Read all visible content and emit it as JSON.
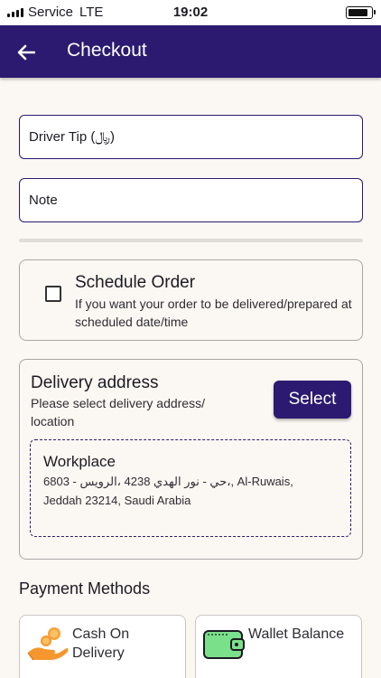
{
  "status_bar": {
    "carrier": "Service",
    "network": "LTE",
    "time": "19:02"
  },
  "app_bar": {
    "title": "Checkout"
  },
  "form": {
    "driver_tip_placeholder": "Driver Tip (﷼)",
    "note_placeholder": "Note"
  },
  "schedule": {
    "title": "Schedule Order",
    "description": "If you want your order to be delivered/prepared at scheduled date/time",
    "checked": false
  },
  "delivery": {
    "title": "Delivery address",
    "description": "Please select delivery address/ location",
    "select_label": "Select",
    "address_name": "Workplace",
    "address_line": "6803 - حي - نور الهدي 4238 ،الرويس،, Al-Ruwais, Jeddah 23214, Saudi Arabia"
  },
  "payment": {
    "heading": "Payment Methods",
    "methods": [
      {
        "label": "Cash On Delivery",
        "icon": "cash-hand-icon"
      },
      {
        "label": "Wallet Balance",
        "icon": "wallet-icon"
      }
    ]
  },
  "colors": {
    "primary": "#2b1a70",
    "background": "#fbf8f3",
    "wallet_green": "#7be08a",
    "coin_orange": "#f7a23b"
  }
}
